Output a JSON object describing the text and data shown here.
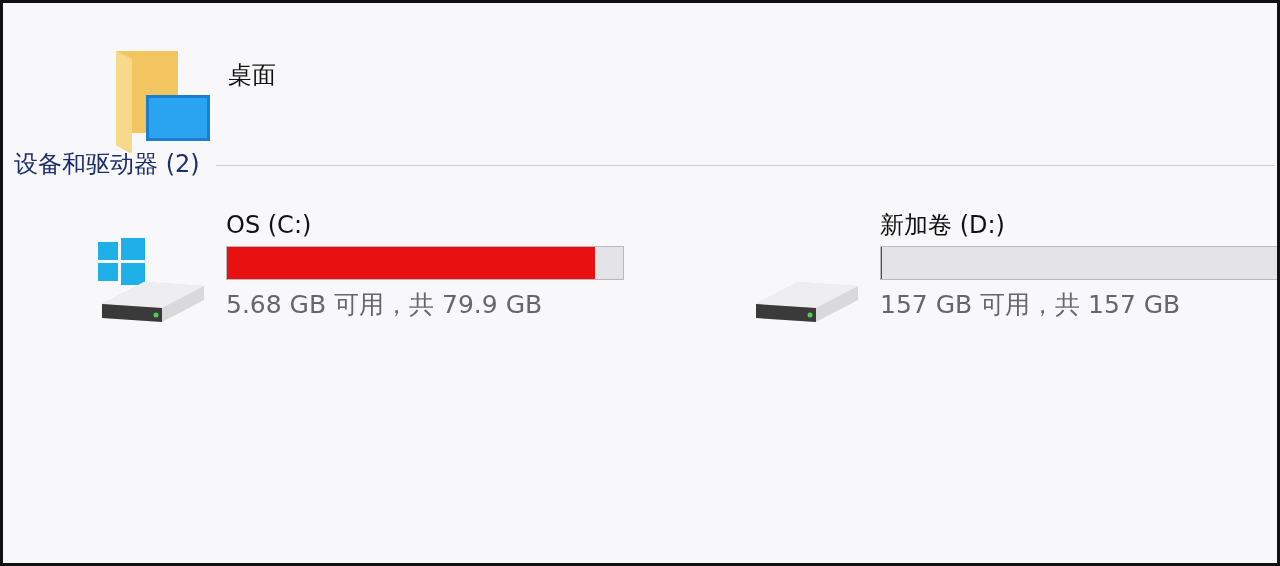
{
  "folders": [
    {
      "name": "桌面"
    }
  ],
  "section": {
    "title": "设备和驱动器 (2)"
  },
  "drives": [
    {
      "kind": "system",
      "name": "OS (C:)",
      "level": 0.93,
      "info": "5.68 GB 可用，共 79.9 GB"
    },
    {
      "kind": "plain",
      "name": "新加卷 (D:)",
      "level": 0,
      "info": "157 GB 可用，共 157 GB"
    }
  ]
}
